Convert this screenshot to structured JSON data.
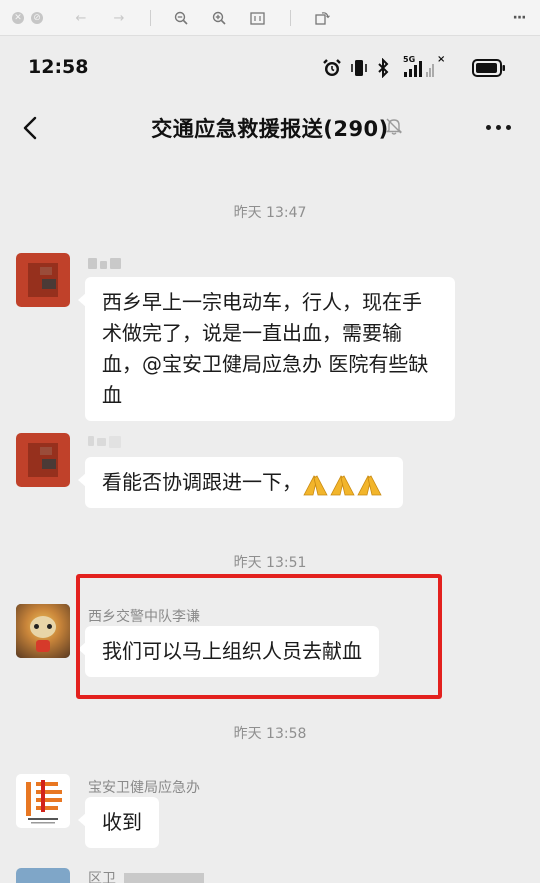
{
  "status": {
    "time": "12:58",
    "network": "5G"
  },
  "header": {
    "title": "交通应急救援报送(290)"
  },
  "messages": {
    "t1": "昨天 13:47",
    "m1_text": "西乡早上一宗电动车，行人，现在手术做完了，说是一直出血，需要输血，@宝安卫健局应急办 医院有些缺血",
    "m2_text": "看能否协调跟进一下，",
    "t2": "昨天 13:51",
    "m3_sender": "西乡交警中队李谦",
    "m3_text": "我们可以马上组织人员去献血",
    "t3": "昨天 13:58",
    "m4_sender": "宝安卫健局应急办",
    "m4_text": "收到",
    "m5_sender": "区卫"
  },
  "icons": [
    "close-icon",
    "back-icon",
    "forward-icon",
    "zoom-out-icon",
    "zoom-in-icon",
    "fit-icon",
    "rotate-icon",
    "more-icon",
    "alarm-icon",
    "vibrate-icon",
    "bluetooth-icon",
    "signal-icon",
    "battery-icon",
    "mute-icon",
    "pray-emoji-icon"
  ],
  "colors": {
    "background": "#ededed",
    "bubble": "#ffffff",
    "highlight": "#e3211e",
    "brand_orange": "#e87722"
  }
}
